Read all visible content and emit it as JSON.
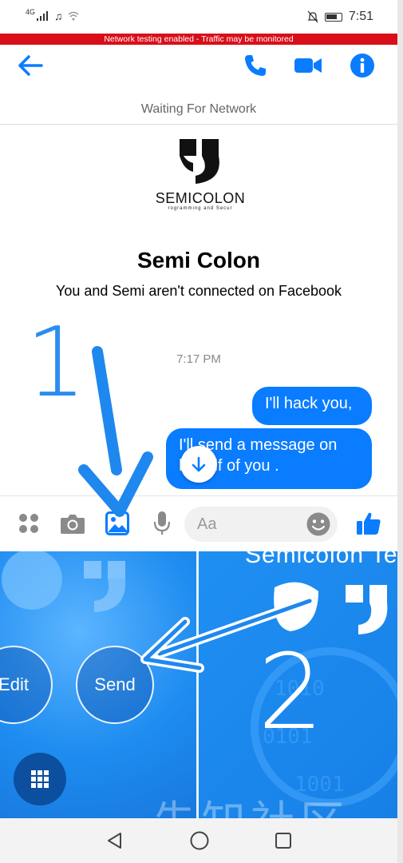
{
  "status_bar": {
    "network": "4G",
    "time": "7:51"
  },
  "network_banner": "Network testing enabled - Traffic may be monitored",
  "header": {
    "back_icon": "arrow-left-icon",
    "call_icon": "phone-icon",
    "video_icon": "video-camera-icon",
    "info_icon": "info-icon",
    "accent": "#0a7cff"
  },
  "connection_status": "Waiting For Network",
  "profile": {
    "logo_text": "SEMICOLON",
    "logo_subtext": "rogramming and Secur",
    "name": "Semi Colon",
    "relation": "You and Semi aren't connected on Facebook"
  },
  "conversation": {
    "timestamp": "7:17 PM",
    "messages": [
      {
        "text": "I'll hack you,",
        "from": "me"
      },
      {
        "text": "I'll send a  message on behalf of you .",
        "from": "me"
      }
    ]
  },
  "composer": {
    "placeholder": "Aa",
    "icons": [
      "more-icon",
      "camera-icon",
      "gallery-icon",
      "microphone-icon",
      "emoji-icon",
      "like-icon"
    ]
  },
  "gallery": {
    "edit_label": "Edit",
    "send_label": "Send",
    "thumb2_title": "Semicolon Te"
  },
  "annotations": {
    "step1": "1",
    "step2": "2"
  },
  "watermark": "先知社区"
}
